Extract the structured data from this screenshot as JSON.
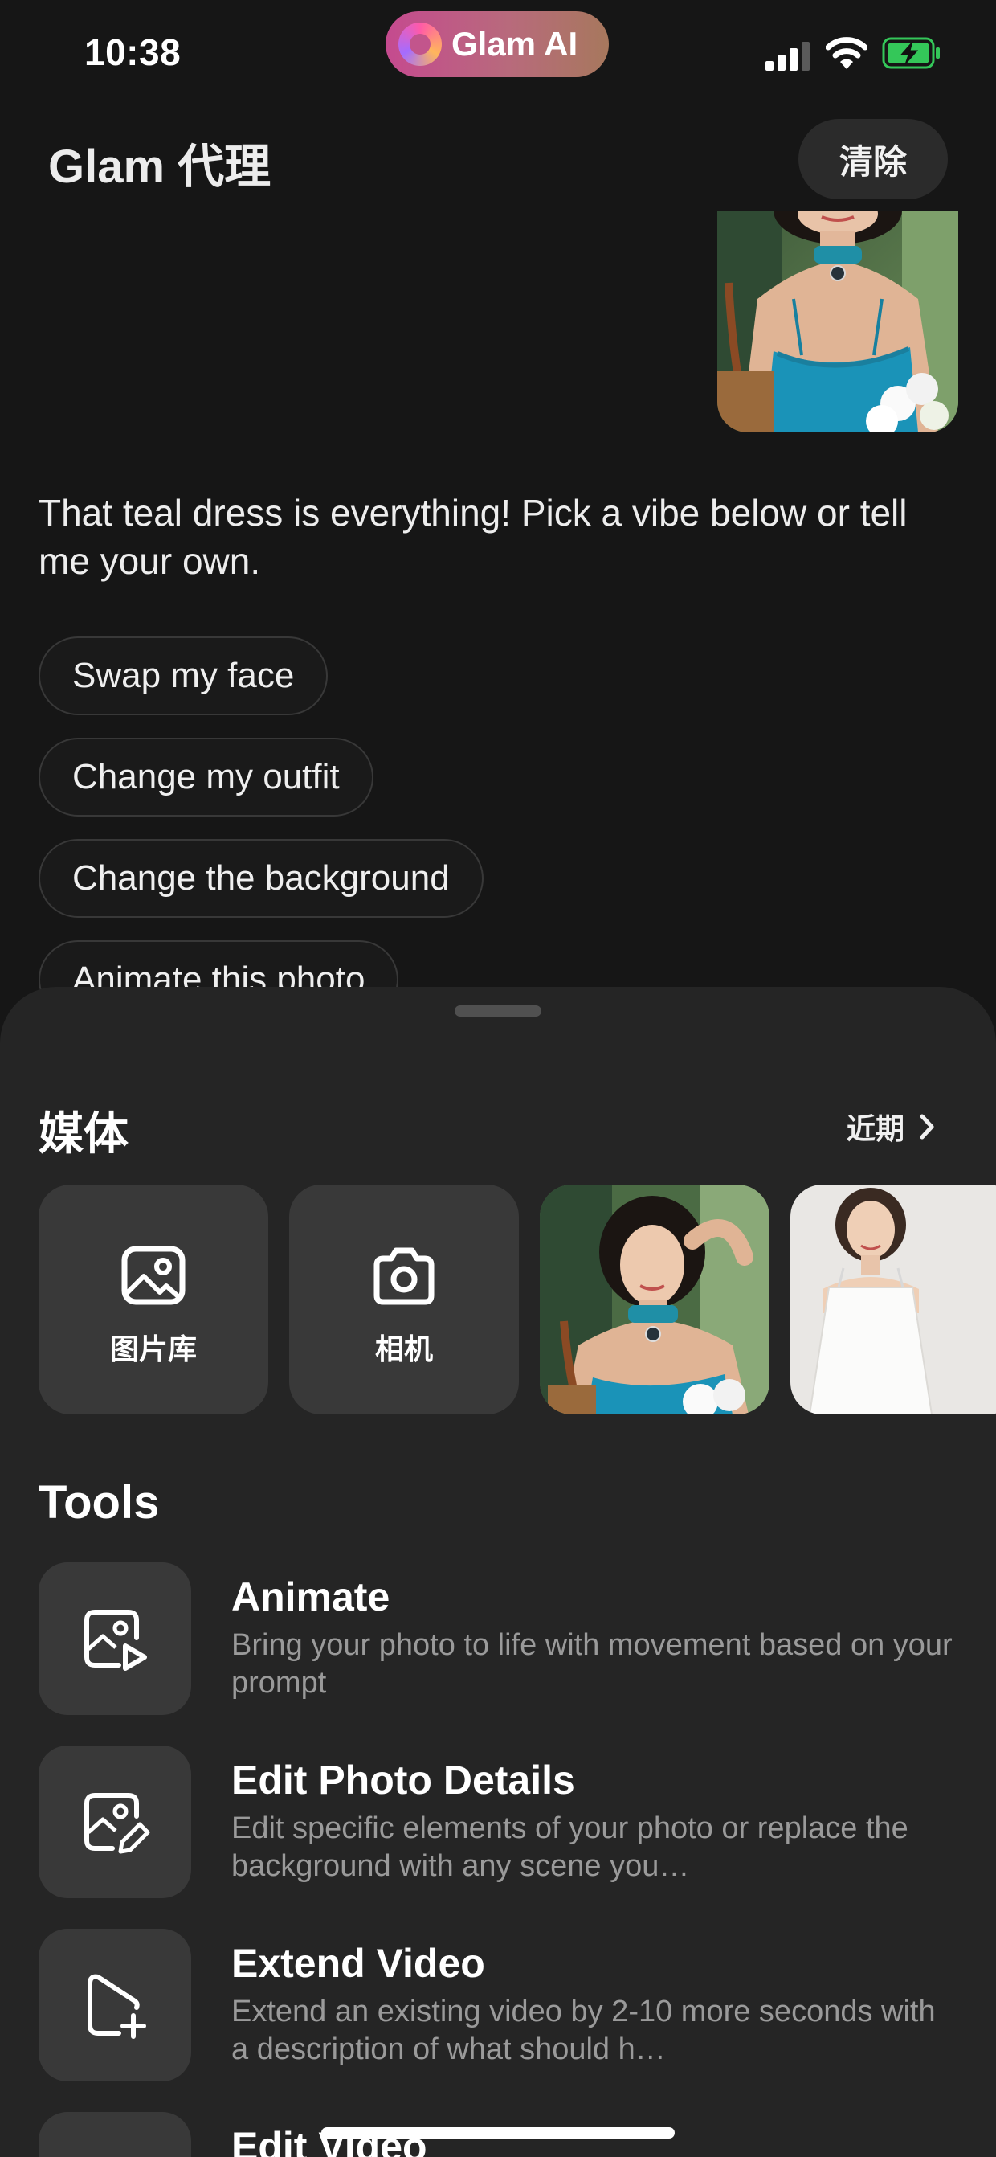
{
  "status_bar": {
    "time": "10:38",
    "dynamic_island": {
      "label": "Glam AI",
      "icon": "glam-logo-icon"
    },
    "icons": [
      "cellular-signal-icon",
      "wifi-icon",
      "battery-charging-icon"
    ]
  },
  "header": {
    "title": "Glam 代理",
    "clear_label": "清除"
  },
  "chat": {
    "photo": "user-uploaded-photo",
    "message": "That teal dress is everything! Pick a vibe below or tell me your own.",
    "suggestions": [
      "Swap my face",
      "Change my outfit",
      "Change the background",
      "Animate this photo"
    ]
  },
  "sheet": {
    "media": {
      "title": "媒体",
      "recent_label": "近期",
      "tiles": [
        {
          "label": "图片库",
          "icon": "gallery-icon"
        },
        {
          "label": "相机",
          "icon": "camera-icon"
        }
      ],
      "thumbnails": [
        "photo-teal-dress",
        "photo-white-dress"
      ]
    },
    "tools": {
      "title": "Tools",
      "items": [
        {
          "name": "Animate",
          "description": "Bring your photo to life with movement based on your prompt",
          "icon": "animate-photo-icon"
        },
        {
          "name": "Edit Photo Details",
          "description": "Edit specific elements of your photo or replace the background with any scene you…",
          "icon": "edit-photo-icon"
        },
        {
          "name": "Extend Video",
          "description": "Extend an existing video by 2-10 more seconds with a description of what should h…",
          "icon": "extend-video-icon"
        },
        {
          "name": "Edit Video",
          "description": "",
          "icon": "edit-video-icon"
        }
      ]
    }
  },
  "colors": {
    "background": "#161616",
    "sheet": "#252525",
    "tile": "#393939",
    "island_gradient_start": "#c54a8f",
    "island_gradient_end": "#a7785d",
    "battery_green": "#34c759"
  }
}
